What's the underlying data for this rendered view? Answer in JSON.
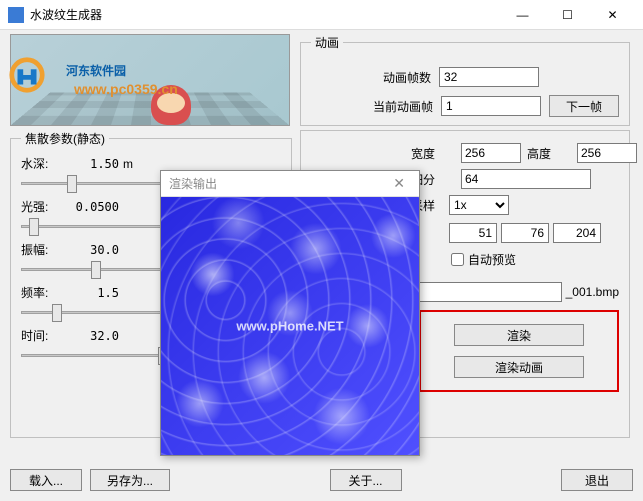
{
  "window": {
    "title": "水波纹生成器",
    "minimize": "—",
    "maximize": "☐",
    "close": "✕"
  },
  "watermark_site": "河东软件园",
  "watermark_url": "www.pc0359.cn",
  "animation": {
    "legend": "动画",
    "frames_label": "动画帧数",
    "frames_value": "32",
    "current_label": "当前动画帧",
    "current_value": "1",
    "next_btn": "下一帧"
  },
  "caustic": {
    "legend": "焦散参数(静态)",
    "depth_label": "水深:",
    "depth_value": "1.50",
    "depth_unit": "m",
    "intensity_label": "光强:",
    "intensity_value": "0.0500",
    "amplitude_label": "振幅:",
    "amplitude_value": "30.0",
    "frequency_label": "频率:",
    "frequency_value": "1.5",
    "time_label": "时间:",
    "time_value": "32.0"
  },
  "output": {
    "width_label": "宽度",
    "width_value": "256",
    "height_label": "高度",
    "height_value": "256",
    "subdiv_label": "细分",
    "subdiv_value": "64",
    "supersample_label": "级采样",
    "supersample_value": "1x",
    "rgb_r": "51",
    "rgb_g": "76",
    "rgb_b": "204",
    "autopreview_label": "自动预览",
    "filename_suffix": "_001.bmp",
    "render_btn": "渲染",
    "render_anim_btn": "渲染动画"
  },
  "bottom": {
    "load": "载入...",
    "saveas": "另存为...",
    "about": "关于...",
    "exit": "退出"
  },
  "modal": {
    "title": "渲染输出",
    "close": "✕",
    "watermark": "www.pHome.NET"
  }
}
